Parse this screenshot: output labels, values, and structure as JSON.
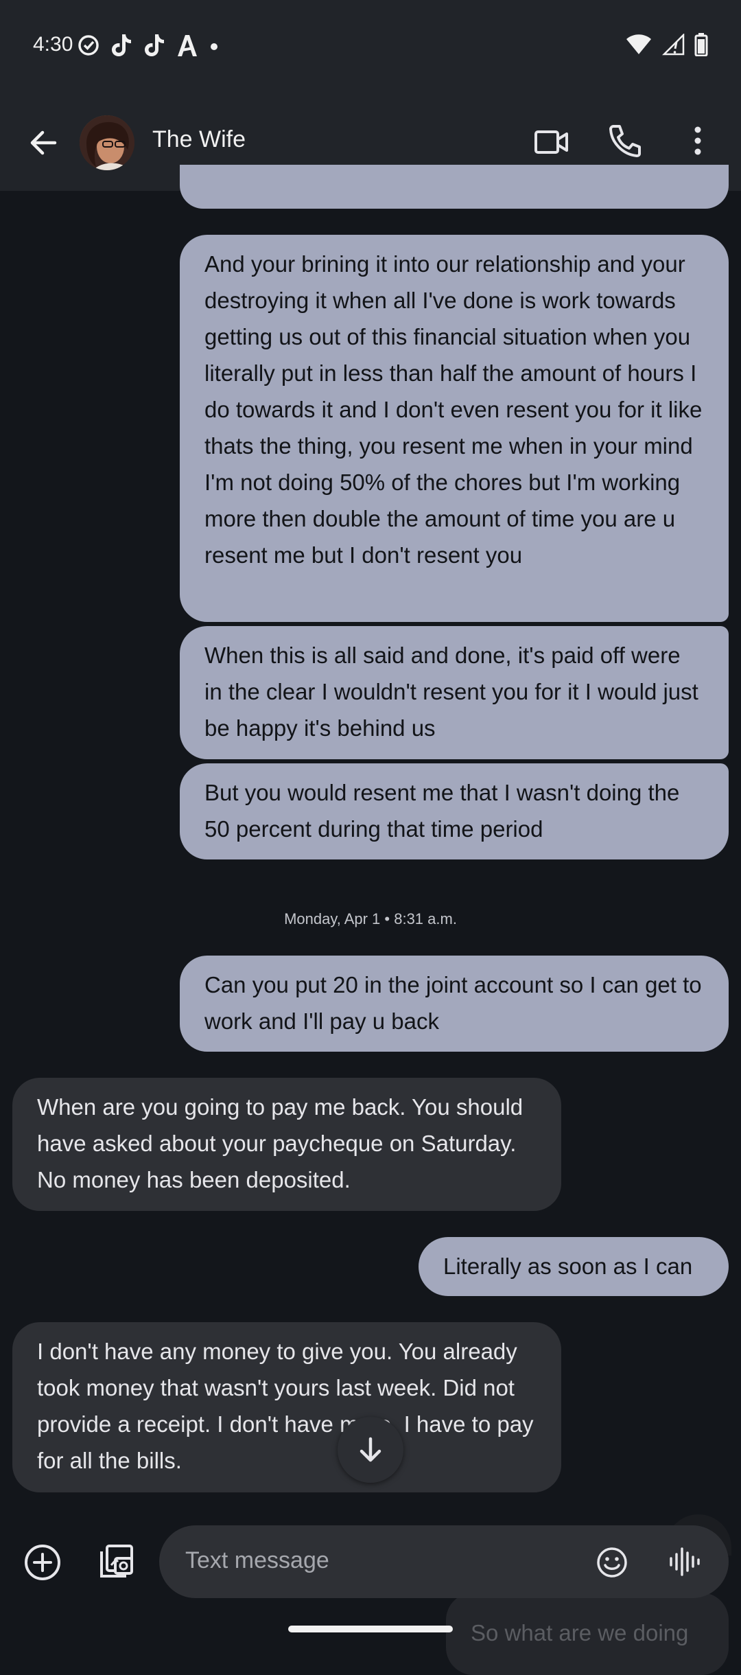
{
  "status_bar": {
    "time": "4:30",
    "left_icons": [
      "check-circle-icon",
      "tiktok-icon",
      "tiktok-icon",
      "a-logo-icon",
      "dot-icon"
    ],
    "right_icons": [
      "wifi-icon",
      "signal-icon",
      "battery-icon"
    ]
  },
  "header": {
    "contact_name": "The Wife",
    "icons": [
      "back-arrow-icon",
      "video-call-icon",
      "phone-icon",
      "more-vert-icon"
    ]
  },
  "conversation": {
    "messages": [
      {
        "type": "sent",
        "text": "And your brining it into our relationship and your destroying it when all I've done is work towards getting us out of this financial situation when you literally put in less than half the amount of hours I do towards it and I don't even resent you for it like thats the thing, you resent me when in your mind I'm not doing 50% of the chores but I'm working more then double the amount of time you are u resent me but I don't resent you"
      },
      {
        "type": "sent",
        "text": "When this is all said and done, it's paid off were in the clear I wouldn't resent you for it I would just be happy it's behind us"
      },
      {
        "type": "sent",
        "text": "But you would resent me that I wasn't doing the 50 percent during that time period"
      },
      {
        "type": "sent",
        "text": "Can you put 20 in the joint account so I can get to work and I'll pay u back"
      },
      {
        "type": "received",
        "text": "When are you going to pay me back. You should have asked about your paycheque on Saturday. No money has been deposited."
      },
      {
        "type": "sent",
        "text": "Literally as soon as I can"
      },
      {
        "type": "received",
        "text": "I don't have any money to give you. You already took money that wasn't yours last week. Did not provide a receipt. I don't have more. I have to pay for all the bills."
      },
      {
        "type": "sent",
        "text": "So what are we doing"
      }
    ],
    "timestamp": "Monday, Apr 1 • 8:31 a.m."
  },
  "composer": {
    "placeholder": "Text message",
    "icons": [
      "add-circle-icon",
      "gallery-icon",
      "emoji-icon",
      "voice-message-icon"
    ]
  },
  "colors": {
    "background": "#13161b",
    "header": "#212429",
    "sent_bubble": "#a3a8bd",
    "received_bubble": "#2e3035"
  }
}
